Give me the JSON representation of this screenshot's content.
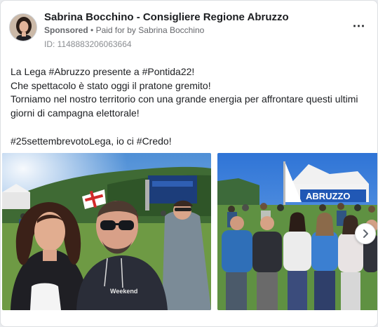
{
  "ad": {
    "page_name": "Sabrina Bocchino - Consigliere Regione Abruzzo",
    "sponsored_label": "Sponsored",
    "paid_for_text": "Paid for by Sabrina Bocchino",
    "separator": "•",
    "id_text": "ID: 1148883206063664",
    "more_icon": "more-dots-icon"
  },
  "post": {
    "lines": [
      "La Lega #Abruzzo presente a #Pontida22!",
      "Che spettacolo è stato oggi il pratone gremito!",
      "Torniamo nel nostro territorio con una grande energia per affrontare questi ultimi giorni di campagna elettorale!"
    ],
    "hashtag_line": "#25settembrevotoLega, io ci #Credo!"
  },
  "gallery": {
    "photo1": {
      "description_icon": "selfie-photo",
      "shirt_text": "Weekend"
    },
    "photo2": {
      "description_icon": "group-photo",
      "banner_text": "ABRUZZO"
    },
    "next_icon": "chevron-right-icon"
  }
}
